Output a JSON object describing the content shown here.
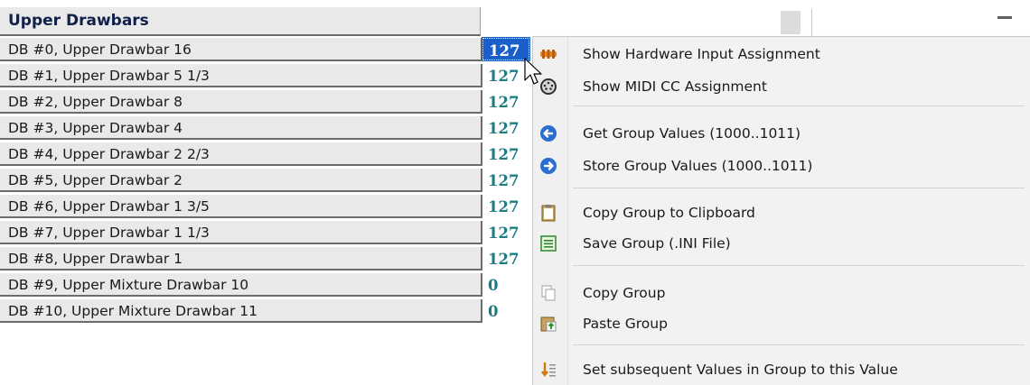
{
  "grid": {
    "header": "Upper Drawbars",
    "rows": [
      {
        "label": "DB #0, Upper Drawbar 16",
        "value": "127"
      },
      {
        "label": "DB #1, Upper Drawbar 5 1/3",
        "value": "127"
      },
      {
        "label": "DB #2, Upper Drawbar 8",
        "value": "127"
      },
      {
        "label": "DB #3, Upper Drawbar 4",
        "value": "127"
      },
      {
        "label": "DB #4, Upper Drawbar 2 2/3",
        "value": "127"
      },
      {
        "label": "DB #5, Upper Drawbar 2",
        "value": "127"
      },
      {
        "label": "DB #6, Upper Drawbar 1 3/5",
        "value": "127"
      },
      {
        "label": "DB #7, Upper Drawbar 1 1/3",
        "value": "127"
      },
      {
        "label": "DB #8, Upper Drawbar 1",
        "value": "127"
      },
      {
        "label": "DB #9, Upper Mixture Drawbar 10",
        "value": "0"
      },
      {
        "label": "DB #10, Upper Mixture Drawbar 11",
        "value": "0"
      }
    ],
    "selected_row": 0
  },
  "context_menu": {
    "items": [
      {
        "label": "Show Hardware Input Assignment",
        "icon": "hardware-input-icon"
      },
      {
        "label": "Show MIDI CC Assignment",
        "icon": "midi-connector-icon"
      },
      {
        "label": "Get Group Values  (1000..1011)",
        "icon": "arrow-left-circle-icon"
      },
      {
        "label": "Store Group Values  (1000..1011)",
        "icon": "arrow-right-circle-icon"
      },
      {
        "label": "Copy Group to Clipboard",
        "icon": "clipboard-icon"
      },
      {
        "label": "Save Group (.INI File)",
        "icon": "save-file-icon"
      },
      {
        "label": "Copy Group",
        "icon": "copy-icon"
      },
      {
        "label": "Paste Group",
        "icon": "paste-icon"
      },
      {
        "label": "Set subsequent Values in Group to this Value",
        "icon": "fill-down-icon"
      }
    ]
  },
  "colors": {
    "value_text": "#1b7c82",
    "selection": "#1a5fc9",
    "label_bg": "#e9e9e9"
  }
}
